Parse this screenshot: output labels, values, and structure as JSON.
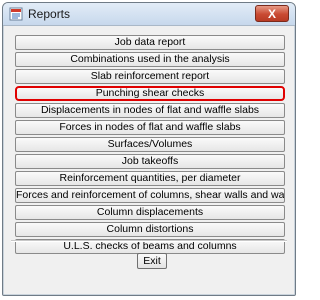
{
  "window": {
    "title": "Reports",
    "close_label": "X"
  },
  "reports": [
    {
      "label": "Job data report",
      "selected": false
    },
    {
      "label": "Combinations used in the analysis",
      "selected": false
    },
    {
      "label": "Slab reinforcement report",
      "selected": false
    },
    {
      "label": "Punching shear checks",
      "selected": true
    },
    {
      "label": "Displacements in nodes of flat and waffle slabs",
      "selected": false
    },
    {
      "label": "Forces in nodes of flat and waffle slabs",
      "selected": false
    },
    {
      "label": "Surfaces/Volumes",
      "selected": false
    },
    {
      "label": "Job takeoffs",
      "selected": false
    },
    {
      "label": "Reinforcement quantities, per diameter",
      "selected": false
    },
    {
      "label": "Forces and reinforcement of columns, shear walls and walls",
      "selected": false
    },
    {
      "label": "Column displacements",
      "selected": false
    },
    {
      "label": "Column distortions",
      "selected": false
    },
    {
      "label": "U.L.S. checks of beams and columns",
      "selected": false
    }
  ],
  "footer": {
    "exit_label": "Exit"
  },
  "colors": {
    "highlight": "#e00000",
    "close_button": "#c94a32"
  },
  "icons": {
    "app": "reports-app-icon"
  }
}
